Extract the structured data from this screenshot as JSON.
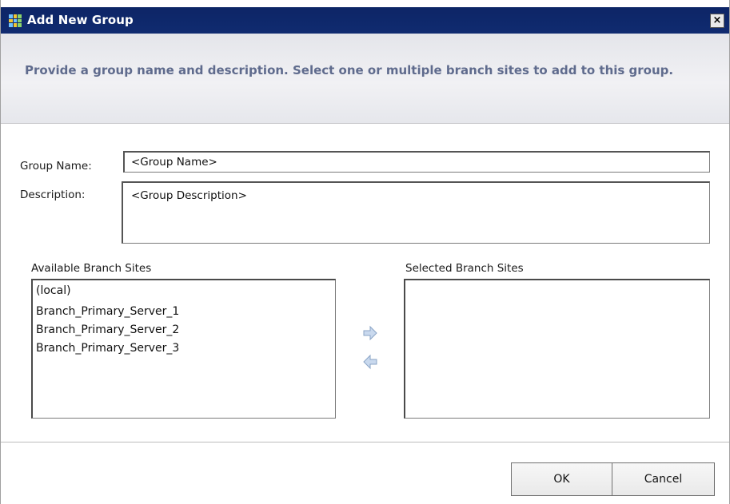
{
  "window": {
    "title": "Add New Group",
    "close_glyph": "×"
  },
  "banner": {
    "instruction": "Provide a group name and description. Select one or multiple branch sites to add to this group."
  },
  "form": {
    "group_name": {
      "label": "Group Name:",
      "value": "<Group Name>"
    },
    "description": {
      "label": "Description:",
      "value": "<Group Description>"
    }
  },
  "available": {
    "label": "Available Branch Sites",
    "items": [
      "(local)",
      "Branch_Primary_Server_1",
      "Branch_Primary_Server_2",
      "Branch_Primary_Server_3"
    ]
  },
  "selected": {
    "label": "Selected Branch Sites",
    "items": []
  },
  "transfer": {
    "add_icon": "arrow-right-icon",
    "remove_icon": "arrow-left-icon"
  },
  "buttons": {
    "ok": "OK",
    "cancel": "Cancel"
  },
  "colors": {
    "titlebar": "#0d2566",
    "banner_text": "#5f6b8d",
    "arrow_fill": "#c9d9ee"
  }
}
